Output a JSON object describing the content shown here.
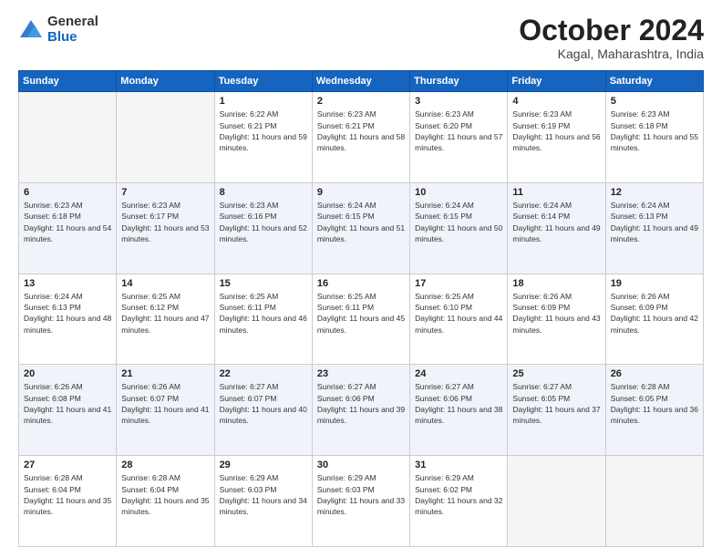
{
  "header": {
    "logo_general": "General",
    "logo_blue": "Blue",
    "month_title": "October 2024",
    "location": "Kagal, Maharashtra, India"
  },
  "days_of_week": [
    "Sunday",
    "Monday",
    "Tuesday",
    "Wednesday",
    "Thursday",
    "Friday",
    "Saturday"
  ],
  "weeks": [
    [
      {
        "day": "",
        "sunrise": "",
        "sunset": "",
        "daylight": ""
      },
      {
        "day": "",
        "sunrise": "",
        "sunset": "",
        "daylight": ""
      },
      {
        "day": "1",
        "sunrise": "Sunrise: 6:22 AM",
        "sunset": "Sunset: 6:21 PM",
        "daylight": "Daylight: 11 hours and 59 minutes."
      },
      {
        "day": "2",
        "sunrise": "Sunrise: 6:23 AM",
        "sunset": "Sunset: 6:21 PM",
        "daylight": "Daylight: 11 hours and 58 minutes."
      },
      {
        "day": "3",
        "sunrise": "Sunrise: 6:23 AM",
        "sunset": "Sunset: 6:20 PM",
        "daylight": "Daylight: 11 hours and 57 minutes."
      },
      {
        "day": "4",
        "sunrise": "Sunrise: 6:23 AM",
        "sunset": "Sunset: 6:19 PM",
        "daylight": "Daylight: 11 hours and 56 minutes."
      },
      {
        "day": "5",
        "sunrise": "Sunrise: 6:23 AM",
        "sunset": "Sunset: 6:18 PM",
        "daylight": "Daylight: 11 hours and 55 minutes."
      }
    ],
    [
      {
        "day": "6",
        "sunrise": "Sunrise: 6:23 AM",
        "sunset": "Sunset: 6:18 PM",
        "daylight": "Daylight: 11 hours and 54 minutes."
      },
      {
        "day": "7",
        "sunrise": "Sunrise: 6:23 AM",
        "sunset": "Sunset: 6:17 PM",
        "daylight": "Daylight: 11 hours and 53 minutes."
      },
      {
        "day": "8",
        "sunrise": "Sunrise: 6:23 AM",
        "sunset": "Sunset: 6:16 PM",
        "daylight": "Daylight: 11 hours and 52 minutes."
      },
      {
        "day": "9",
        "sunrise": "Sunrise: 6:24 AM",
        "sunset": "Sunset: 6:15 PM",
        "daylight": "Daylight: 11 hours and 51 minutes."
      },
      {
        "day": "10",
        "sunrise": "Sunrise: 6:24 AM",
        "sunset": "Sunset: 6:15 PM",
        "daylight": "Daylight: 11 hours and 50 minutes."
      },
      {
        "day": "11",
        "sunrise": "Sunrise: 6:24 AM",
        "sunset": "Sunset: 6:14 PM",
        "daylight": "Daylight: 11 hours and 49 minutes."
      },
      {
        "day": "12",
        "sunrise": "Sunrise: 6:24 AM",
        "sunset": "Sunset: 6:13 PM",
        "daylight": "Daylight: 11 hours and 49 minutes."
      }
    ],
    [
      {
        "day": "13",
        "sunrise": "Sunrise: 6:24 AM",
        "sunset": "Sunset: 6:13 PM",
        "daylight": "Daylight: 11 hours and 48 minutes."
      },
      {
        "day": "14",
        "sunrise": "Sunrise: 6:25 AM",
        "sunset": "Sunset: 6:12 PM",
        "daylight": "Daylight: 11 hours and 47 minutes."
      },
      {
        "day": "15",
        "sunrise": "Sunrise: 6:25 AM",
        "sunset": "Sunset: 6:11 PM",
        "daylight": "Daylight: 11 hours and 46 minutes."
      },
      {
        "day": "16",
        "sunrise": "Sunrise: 6:25 AM",
        "sunset": "Sunset: 6:11 PM",
        "daylight": "Daylight: 11 hours and 45 minutes."
      },
      {
        "day": "17",
        "sunrise": "Sunrise: 6:25 AM",
        "sunset": "Sunset: 6:10 PM",
        "daylight": "Daylight: 11 hours and 44 minutes."
      },
      {
        "day": "18",
        "sunrise": "Sunrise: 6:26 AM",
        "sunset": "Sunset: 6:09 PM",
        "daylight": "Daylight: 11 hours and 43 minutes."
      },
      {
        "day": "19",
        "sunrise": "Sunrise: 6:26 AM",
        "sunset": "Sunset: 6:09 PM",
        "daylight": "Daylight: 11 hours and 42 minutes."
      }
    ],
    [
      {
        "day": "20",
        "sunrise": "Sunrise: 6:26 AM",
        "sunset": "Sunset: 6:08 PM",
        "daylight": "Daylight: 11 hours and 41 minutes."
      },
      {
        "day": "21",
        "sunrise": "Sunrise: 6:26 AM",
        "sunset": "Sunset: 6:07 PM",
        "daylight": "Daylight: 11 hours and 41 minutes."
      },
      {
        "day": "22",
        "sunrise": "Sunrise: 6:27 AM",
        "sunset": "Sunset: 6:07 PM",
        "daylight": "Daylight: 11 hours and 40 minutes."
      },
      {
        "day": "23",
        "sunrise": "Sunrise: 6:27 AM",
        "sunset": "Sunset: 6:06 PM",
        "daylight": "Daylight: 11 hours and 39 minutes."
      },
      {
        "day": "24",
        "sunrise": "Sunrise: 6:27 AM",
        "sunset": "Sunset: 6:06 PM",
        "daylight": "Daylight: 11 hours and 38 minutes."
      },
      {
        "day": "25",
        "sunrise": "Sunrise: 6:27 AM",
        "sunset": "Sunset: 6:05 PM",
        "daylight": "Daylight: 11 hours and 37 minutes."
      },
      {
        "day": "26",
        "sunrise": "Sunrise: 6:28 AM",
        "sunset": "Sunset: 6:05 PM",
        "daylight": "Daylight: 11 hours and 36 minutes."
      }
    ],
    [
      {
        "day": "27",
        "sunrise": "Sunrise: 6:28 AM",
        "sunset": "Sunset: 6:04 PM",
        "daylight": "Daylight: 11 hours and 35 minutes."
      },
      {
        "day": "28",
        "sunrise": "Sunrise: 6:28 AM",
        "sunset": "Sunset: 6:04 PM",
        "daylight": "Daylight: 11 hours and 35 minutes."
      },
      {
        "day": "29",
        "sunrise": "Sunrise: 6:29 AM",
        "sunset": "Sunset: 6:03 PM",
        "daylight": "Daylight: 11 hours and 34 minutes."
      },
      {
        "day": "30",
        "sunrise": "Sunrise: 6:29 AM",
        "sunset": "Sunset: 6:03 PM",
        "daylight": "Daylight: 11 hours and 33 minutes."
      },
      {
        "day": "31",
        "sunrise": "Sunrise: 6:29 AM",
        "sunset": "Sunset: 6:02 PM",
        "daylight": "Daylight: 11 hours and 32 minutes."
      },
      {
        "day": "",
        "sunrise": "",
        "sunset": "",
        "daylight": ""
      },
      {
        "day": "",
        "sunrise": "",
        "sunset": "",
        "daylight": ""
      }
    ]
  ]
}
